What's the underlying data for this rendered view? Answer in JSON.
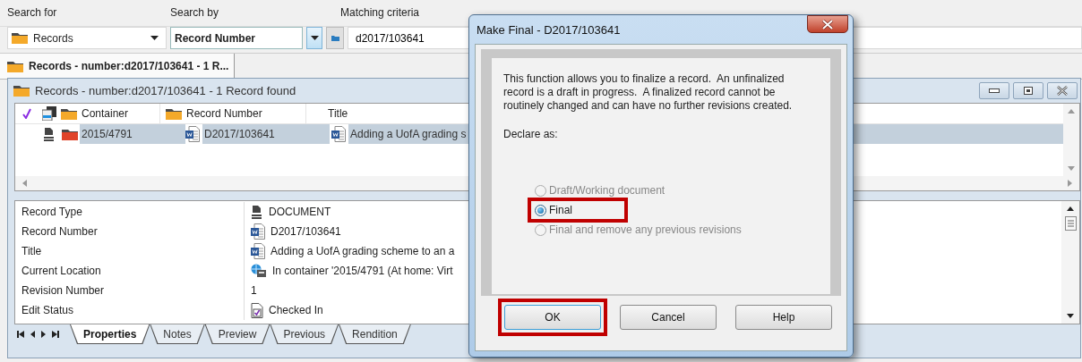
{
  "search": {
    "fields": [
      {
        "label": "Search for",
        "value": "Records",
        "kind": "records"
      },
      {
        "label": "Search by",
        "value": "Record Number",
        "kind": "by"
      },
      {
        "label": "Matching criteria",
        "value": "d2017/103641",
        "kind": "text"
      }
    ]
  },
  "doc_tabs": [
    {
      "label": "Records - number:d2017/103641 - 1 R...",
      "selected": true
    }
  ],
  "results_window": {
    "title": "Records - number:d2017/103641 - 1 Record found",
    "columns": [
      {
        "label": "Container"
      },
      {
        "label": "Record Number"
      },
      {
        "label": "Title"
      }
    ],
    "rows": [
      {
        "container": "2015/4791",
        "record_number": "D2017/103641",
        "title": "Adding a UofA grading s",
        "selected": true
      }
    ]
  },
  "properties": [
    {
      "label": "Record Type",
      "value": "DOCUMENT",
      "kind": "doctype"
    },
    {
      "label": "Record Number",
      "value": "D2017/103641",
      "kind": "word"
    },
    {
      "label": "Title",
      "value": "Adding a UofA grading scheme to an a",
      "kind": "word"
    },
    {
      "label": "Current Location",
      "value": "In container '2015/4791 (At home: Virt",
      "kind": "location"
    },
    {
      "label": "Revision Number",
      "value": "1",
      "kind": "plain"
    },
    {
      "label": "Edit Status",
      "value": "Checked In",
      "kind": "checkedin"
    }
  ],
  "bottom_tabs": [
    {
      "label": "Properties",
      "selected": true
    },
    {
      "label": "Notes",
      "selected": false
    },
    {
      "label": "Preview",
      "selected": false
    },
    {
      "label": "Previous",
      "selected": false
    },
    {
      "label": "Rendition",
      "selected": false
    }
  ],
  "dialog": {
    "title": "Make Final - D2017/103641",
    "description": "This function allows you to finalize a record.  An unfinalized record is a draft in progress.  A finalized record cannot be routinely changed and can have no further revisions created.",
    "declare_label": "Declare as:",
    "options": [
      {
        "label": "Draft/Working document",
        "selected": false,
        "disabled": true,
        "highlighted": false
      },
      {
        "label": "Final",
        "selected": true,
        "disabled": false,
        "highlighted": true
      },
      {
        "label": "Final and remove any previous revisions",
        "selected": false,
        "disabled": true,
        "highlighted": false
      }
    ],
    "buttons": [
      {
        "label": "OK",
        "highlighted": true
      },
      {
        "label": "Cancel",
        "highlighted": false
      },
      {
        "label": "Help",
        "highlighted": false
      }
    ]
  }
}
